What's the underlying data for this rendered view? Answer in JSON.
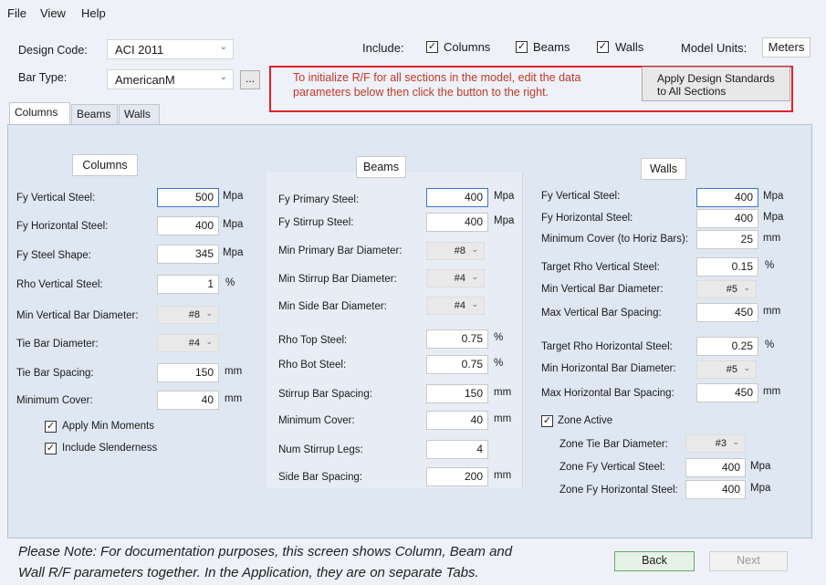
{
  "menu": [
    "File",
    "View",
    "Help"
  ],
  "header": {
    "design_code_label": "Design Code:",
    "design_code_value": "ACI 2011",
    "bar_type_label": "Bar Type:",
    "bar_type_value": "AmericanM",
    "browse_label": "...",
    "include_label": "Include:",
    "include_columns": "Columns",
    "include_beams": "Beams",
    "include_walls": "Walls",
    "model_units_label": "Model Units:",
    "model_units_value": "Meters",
    "init_message": "To initialize R/F for all sections in the model, edit the data parameters below then click the button to the right.",
    "apply_line1": "Apply Design Standards",
    "apply_line2": "to All Sections"
  },
  "tabs": [
    "Columns",
    "Beams",
    "Walls"
  ],
  "columns": {
    "title": "Columns",
    "fy_vertical_label": "Fy Vertical Steel:",
    "fy_vertical_value": "500",
    "fy_vertical_unit": "Mpa",
    "fy_horizontal_label": "Fy Horizontal Steel:",
    "fy_horizontal_value": "400",
    "fy_horizontal_unit": "Mpa",
    "fy_shape_label": "Fy Steel Shape:",
    "fy_shape_value": "345",
    "fy_shape_unit": "Mpa",
    "rho_vertical_label": "Rho Vertical Steel:",
    "rho_vertical_value": "1",
    "rho_vertical_unit": "%",
    "min_vert_dia_label": "Min Vertical Bar Diameter:",
    "min_vert_dia_value": "#8",
    "tie_dia_label": "Tie Bar Diameter:",
    "tie_dia_value": "#4",
    "tie_spacing_label": "Tie Bar Spacing:",
    "tie_spacing_value": "150",
    "tie_spacing_unit": "mm",
    "min_cover_label": "Minimum Cover:",
    "min_cover_value": "40",
    "min_cover_unit": "mm",
    "apply_min_moments": "Apply Min Moments",
    "include_slenderness": "Include Slenderness"
  },
  "beams": {
    "title": "Beams",
    "fy_primary_label": "Fy Primary Steel:",
    "fy_primary_value": "400",
    "fy_primary_unit": "Mpa",
    "fy_stirrup_label": "Fy Stirrup Steel:",
    "fy_stirrup_value": "400",
    "fy_stirrup_unit": "Mpa",
    "min_primary_dia_label": "Min Primary Bar Diameter:",
    "min_primary_dia_value": "#8",
    "min_stirrup_dia_label": "Min Stirrup Bar Diameter:",
    "min_stirrup_dia_value": "#4",
    "min_side_dia_label": "Min Side Bar Diameter:",
    "min_side_dia_value": "#4",
    "rho_top_label": "Rho Top Steel:",
    "rho_top_value": "0.75",
    "rho_top_unit": "%",
    "rho_bot_label": "Rho Bot Steel:",
    "rho_bot_value": "0.75",
    "rho_bot_unit": "%",
    "stirrup_spacing_label": "Stirrup Bar Spacing:",
    "stirrup_spacing_value": "150",
    "stirrup_spacing_unit": "mm",
    "min_cover_label": "Minimum Cover:",
    "min_cover_value": "40",
    "min_cover_unit": "mm",
    "stirrup_legs_label": "Num Stirrup Legs:",
    "stirrup_legs_value": "4",
    "side_spacing_label": "Side Bar Spacing:",
    "side_spacing_value": "200",
    "side_spacing_unit": "mm"
  },
  "walls": {
    "title": "Walls",
    "fy_vertical_label": "Fy Vertical Steel:",
    "fy_vertical_value": "400",
    "fy_vertical_unit": "Mpa",
    "fy_horizontal_label": "Fy Horizontal Steel:",
    "fy_horizontal_value": "400",
    "fy_horizontal_unit": "Mpa",
    "min_cover_label": "Minimum Cover (to Horiz Bars):",
    "min_cover_value": "25",
    "min_cover_unit": "mm",
    "target_rho_vert_label": "Target Rho Vertical Steel:",
    "target_rho_vert_value": "0.15",
    "target_rho_vert_unit": "%",
    "min_vert_dia_label": "Min Vertical Bar Diameter:",
    "min_vert_dia_value": "#5",
    "max_vert_spacing_label": "Max Vertical Bar Spacing:",
    "max_vert_spacing_value": "450",
    "max_vert_spacing_unit": "mm",
    "target_rho_horiz_label": "Target Rho Horizontal Steel:",
    "target_rho_horiz_value": "0.25",
    "target_rho_horiz_unit": "%",
    "min_horiz_dia_label": "Min Horizontal Bar Diameter:",
    "min_horiz_dia_value": "#5",
    "max_horiz_spacing_label": "Max Horizontal Bar Spacing:",
    "max_horiz_spacing_value": "450",
    "max_horiz_spacing_unit": "mm",
    "zone_active": "Zone Active",
    "zone_tie_dia_label": "Zone Tie Bar Diameter:",
    "zone_tie_dia_value": "#3",
    "zone_fy_vert_label": "Zone Fy Vertical Steel:",
    "zone_fy_vert_value": "400",
    "zone_fy_vert_unit": "Mpa",
    "zone_fy_horiz_label": "Zone Fy Horizontal Steel:",
    "zone_fy_horiz_value": "400",
    "zone_fy_horiz_unit": "Mpa"
  },
  "footer": {
    "note_line1": "Please Note:  For documentation purposes, this screen shows Column, Beam and",
    "note_line2": "Wall R/F parameters together.  In the Application, they are on separate Tabs.",
    "back": "Back",
    "next": "Next"
  },
  "colors": {
    "message_red": "#c0392b",
    "highlight_border": "#e0202a"
  }
}
